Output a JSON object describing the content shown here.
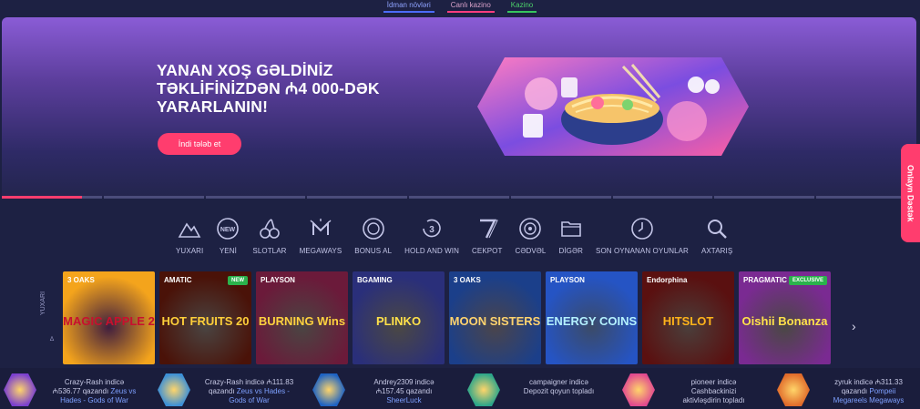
{
  "top_nav": {
    "sports": "İdman növləri",
    "live_casino": "Canlı kazino",
    "casino": "Kazino"
  },
  "hero": {
    "title_line1": "YANAN XOŞ GƏLDİNİZ",
    "title_line2": "TƏKLİFİNİZDƏN ₼4 000-DƏK",
    "title_line3": "YARARLANIN!",
    "cta": "İndi tələb et"
  },
  "support_tab": "Onlayn Dəstək",
  "categories": [
    {
      "icon": "mountain-icon",
      "label": "YUXARI"
    },
    {
      "icon": "new-badge-icon",
      "label": "YENİ"
    },
    {
      "icon": "cherries-icon",
      "label": "SLOTLAR"
    },
    {
      "icon": "megaways-icon",
      "label": "MEGAWAYS"
    },
    {
      "icon": "bonus-coin-icon",
      "label": "BONUS AL"
    },
    {
      "icon": "hold-and-win-icon",
      "label": "HOLD AND WIN"
    },
    {
      "icon": "seven-icon",
      "label": "CEKPOT"
    },
    {
      "icon": "roulette-icon",
      "label": "CƏDVƏL"
    },
    {
      "icon": "folder-icon",
      "label": "DİGƏR"
    },
    {
      "icon": "history-clock-icon",
      "label": "SON OYNANAN OYUNLAR"
    },
    {
      "icon": "search-icon",
      "label": "AXTARIŞ"
    }
  ],
  "games_side_label": "YUXARI",
  "games": [
    {
      "provider": "3 OAKS",
      "name": "MAGIC APPLE 2",
      "badge": "",
      "bg": "#f4a41c",
      "fg": "#c8102e"
    },
    {
      "provider": "AMATIC",
      "name": "HOT FRUITS 20",
      "badge": "NEW",
      "bg": "#4a1208",
      "fg": "#ffcf3a"
    },
    {
      "provider": "PLAYSON",
      "name": "BURNING Wins",
      "badge": "",
      "bg": "#6b1a3a",
      "fg": "#ffd23f"
    },
    {
      "provider": "BGAMING",
      "name": "PLINKO",
      "badge": "",
      "bg": "#2a2f7a",
      "fg": "#ffe14a"
    },
    {
      "provider": "3 OAKS",
      "name": "MOON SISTERS",
      "badge": "",
      "bg": "#1b3f8a",
      "fg": "#ffd36e"
    },
    {
      "provider": "PLAYSON",
      "name": "ENERGY COINS",
      "badge": "",
      "bg": "#2554c4",
      "fg": "#b4f1ff"
    },
    {
      "provider": "Endorphina",
      "name": "HITSLOT",
      "badge": "",
      "bg": "#5a1010",
      "fg": "#ffb31a"
    },
    {
      "provider": "PRAGMATIC PLAY",
      "name": "Oishii Bonanza",
      "badge": "EXCLUSIVE",
      "bg": "#7a2a92",
      "fg": "#ffe24a"
    }
  ],
  "wins": [
    {
      "user": "Crazy-Rash",
      "amount": "₼536.77",
      "game": "Zeus vs Hades - Gods of War",
      "line1": "Crazy-Rash indicə",
      "line2a": "₼536.77 qazandı ",
      "line2b": "Zeus vs",
      "line3": "Hades - Gods of War"
    },
    {
      "user": "Crazy-Rash",
      "amount": "₼111.83",
      "game": "Zeus vs Hades - Gods of War",
      "line1": "Crazy-Rash indicə ₼111.83",
      "line2a": "qazandı ",
      "line2b": "Zeus vs Hades -",
      "line3": "Gods of War"
    },
    {
      "user": "Andrey2309",
      "amount": "₼157.45",
      "game": "SheerLuck",
      "line1": "Andrey2309 indicə",
      "line2a": "₼157.45 qazandı",
      "line2b": "",
      "line3": "SheerLuck"
    },
    {
      "user": "campaigner",
      "line1": "campaigner indicə",
      "line2a": "Depozit qoyun topladı",
      "line2b": "",
      "line3": ""
    },
    {
      "user": "pioneer",
      "line1": "pioneer indicə",
      "line2a": "Cashbackinizi",
      "line2b": "",
      "line3": "aktivləşdirin topladı"
    },
    {
      "user": "zyruk",
      "amount": "₼311.33",
      "game": "Pompeii Megareels Megaways",
      "line1": "zyruk indicə ₼311.33",
      "line2a": "qazandı ",
      "line2b": "Pompeii",
      "line3": "Megareels Megaways"
    }
  ],
  "colors": {
    "accent": "#ff3d6e",
    "background": "#1d2143",
    "hero_top": "#8a5cd6"
  }
}
